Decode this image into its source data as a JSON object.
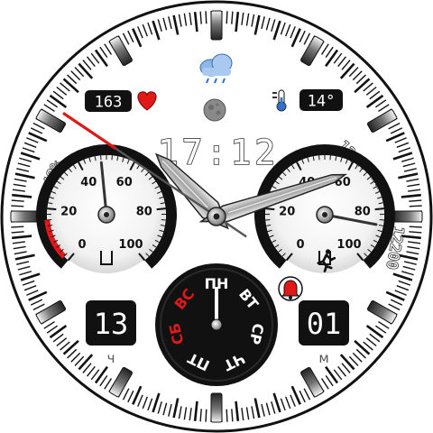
{
  "time": {
    "digital": "17:12",
    "hour_hand_deg": 316,
    "minute_hand_deg": 72,
    "second_hand_deg": 304
  },
  "heart_rate": {
    "value": "163"
  },
  "temperature": {
    "value": "14°"
  },
  "weather": {
    "icon": "cloud-rain-icon"
  },
  "moon": {
    "icon": "moon-phase-icon"
  },
  "battery": {
    "label": "48%",
    "percent": 48
  },
  "distance": {
    "label": "12.6 км"
  },
  "steps": {
    "label": "12200",
    "percent": 86
  },
  "hours_box": {
    "value": "13",
    "caption": "ч"
  },
  "minutes_box": {
    "value": "01",
    "caption": "м"
  },
  "alarm": {
    "icon": "alarm-bell-icon"
  },
  "steps_icon": "running-man-icon",
  "heart_icon": "heart-icon",
  "thermo_icon": "thermometer-icon",
  "gauge_ticks": [
    "0",
    "20",
    "40",
    "60",
    "80",
    "100"
  ],
  "weekdays": {
    "items": [
      "ПН",
      "ВТ",
      "СР",
      "ЧТ",
      "ПТ",
      "СБ",
      "ВС"
    ],
    "active_index": 0,
    "accent_color": "#e01818"
  },
  "colors": {
    "accent": "#e01818",
    "face": "#ffffff",
    "bezel": "#111111"
  }
}
